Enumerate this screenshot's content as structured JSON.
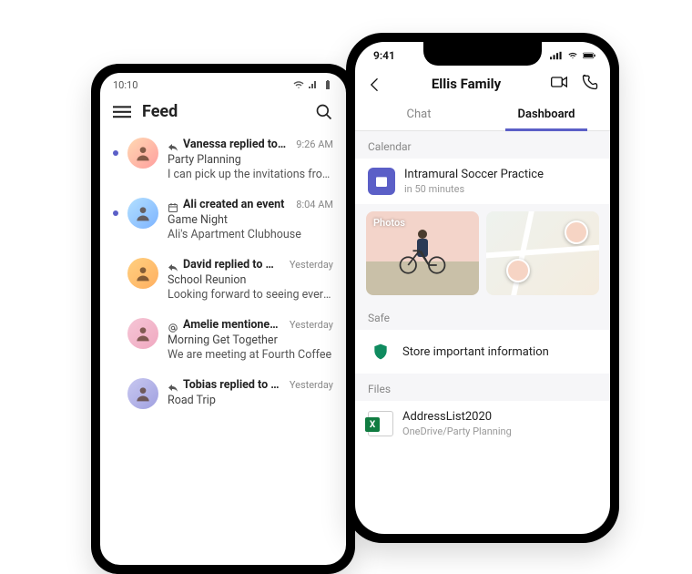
{
  "left": {
    "status_time": "10:10",
    "header_title": "Feed",
    "items": [
      {
        "headline": "Vanessa replied to you",
        "subject": "Party Planning",
        "preview": "I can pick up the invitations from printer",
        "time": "9:26 AM",
        "icon": "reply",
        "unread": true
      },
      {
        "headline": "Ali created an event",
        "subject": "Game Night",
        "preview": "Ali's Apartment Clubhouse",
        "time": "8:04 AM",
        "icon": "event",
        "unread": true
      },
      {
        "headline": "David replied to you",
        "subject": "School Reunion",
        "preview": "Looking forward to seeing everyone",
        "time": "Yesterday",
        "icon": "reply",
        "unread": false
      },
      {
        "headline": "Amelie mentioned you",
        "subject": "Morning Get Together",
        "preview": "We are meeting at Fourth Coffee",
        "time": "Yesterday",
        "icon": "mention",
        "unread": false
      },
      {
        "headline": "Tobias replied to you",
        "subject": "Road Trip",
        "preview": "",
        "time": "Yesterday",
        "icon": "reply",
        "unread": false
      }
    ]
  },
  "right": {
    "status_time": "9:41",
    "title": "Ellis Family",
    "tabs": {
      "chat": "Chat",
      "dashboard": "Dashboard"
    },
    "calendar": {
      "label": "Calendar",
      "event_title": "Intramural Soccer Practice",
      "event_sub": "in 50 minutes"
    },
    "photos_label": "Photos",
    "safe": {
      "label": "Safe",
      "text": "Store important information"
    },
    "files": {
      "label": "Files",
      "name": "AddressList2020",
      "sub": "OneDrive/Party Planning"
    }
  }
}
